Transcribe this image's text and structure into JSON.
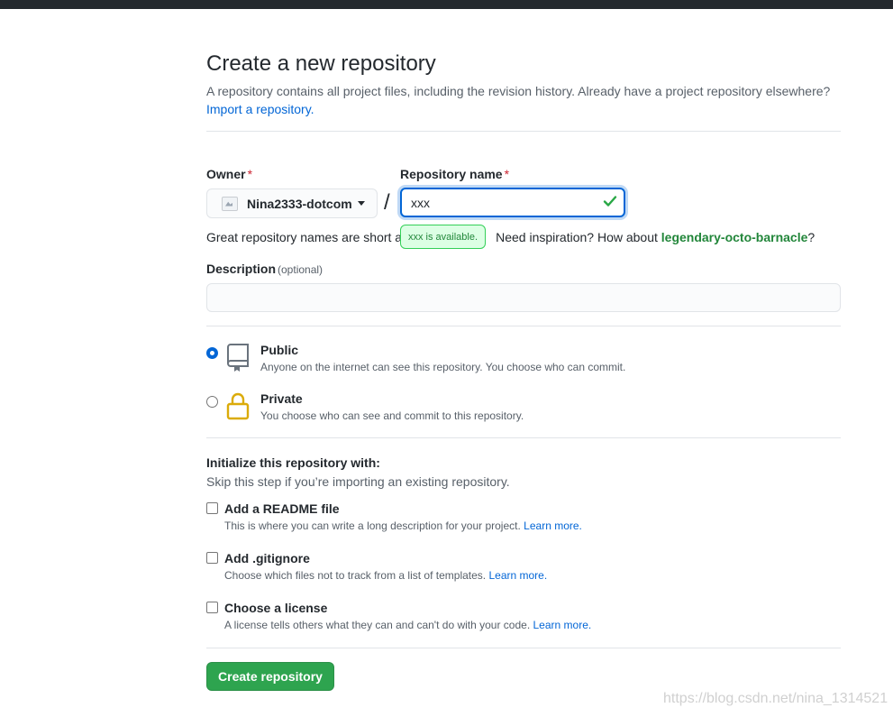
{
  "page": {
    "title": "Create a new repository",
    "subtitle": "A repository contains all project files, including the revision history. Already have a project repository elsewhere?",
    "import_link": "Import a repository."
  },
  "owner": {
    "label": "Owner",
    "required_mark": "*",
    "value": "Nina2333-dotcom"
  },
  "repo_name": {
    "label": "Repository name",
    "required_mark": "*",
    "value": "xxx",
    "available_tooltip": "xxx is available.",
    "hint_prefix": "Great repository names are short a",
    "hint_mid": "Need inspiration? How about",
    "suggestion": "legendary-octo-barnacle",
    "hint_suffix": "?"
  },
  "description": {
    "label": "Description",
    "optional": "(optional)",
    "value": ""
  },
  "visibility": {
    "selected": "public",
    "options": [
      {
        "id": "public",
        "title": "Public",
        "desc": "Anyone on the internet can see this repository. You choose who can commit.",
        "icon": "repo-icon"
      },
      {
        "id": "private",
        "title": "Private",
        "desc": "You choose who can see and commit to this repository.",
        "icon": "lock-icon"
      }
    ]
  },
  "initialize": {
    "title": "Initialize this repository with:",
    "subtitle": "Skip this step if you’re importing an existing repository.",
    "items": [
      {
        "title": "Add a README file",
        "desc": "This is where you can write a long description for your project.",
        "link": "Learn more.",
        "checked": false
      },
      {
        "title": "Add .gitignore",
        "desc": "Choose which files not to track from a list of templates.",
        "link": "Learn more.",
        "checked": false
      },
      {
        "title": "Choose a license",
        "desc": "A license tells others what they can and can't do with your code.",
        "link": "Learn more.",
        "checked": false
      }
    ]
  },
  "submit": {
    "label": "Create repository"
  },
  "watermark": "https://blog.csdn.net/nina_1314521",
  "colors": {
    "primary_button": "#2ea44f",
    "link": "#0366d6",
    "success": "#22863a",
    "required": "#cb2431"
  }
}
